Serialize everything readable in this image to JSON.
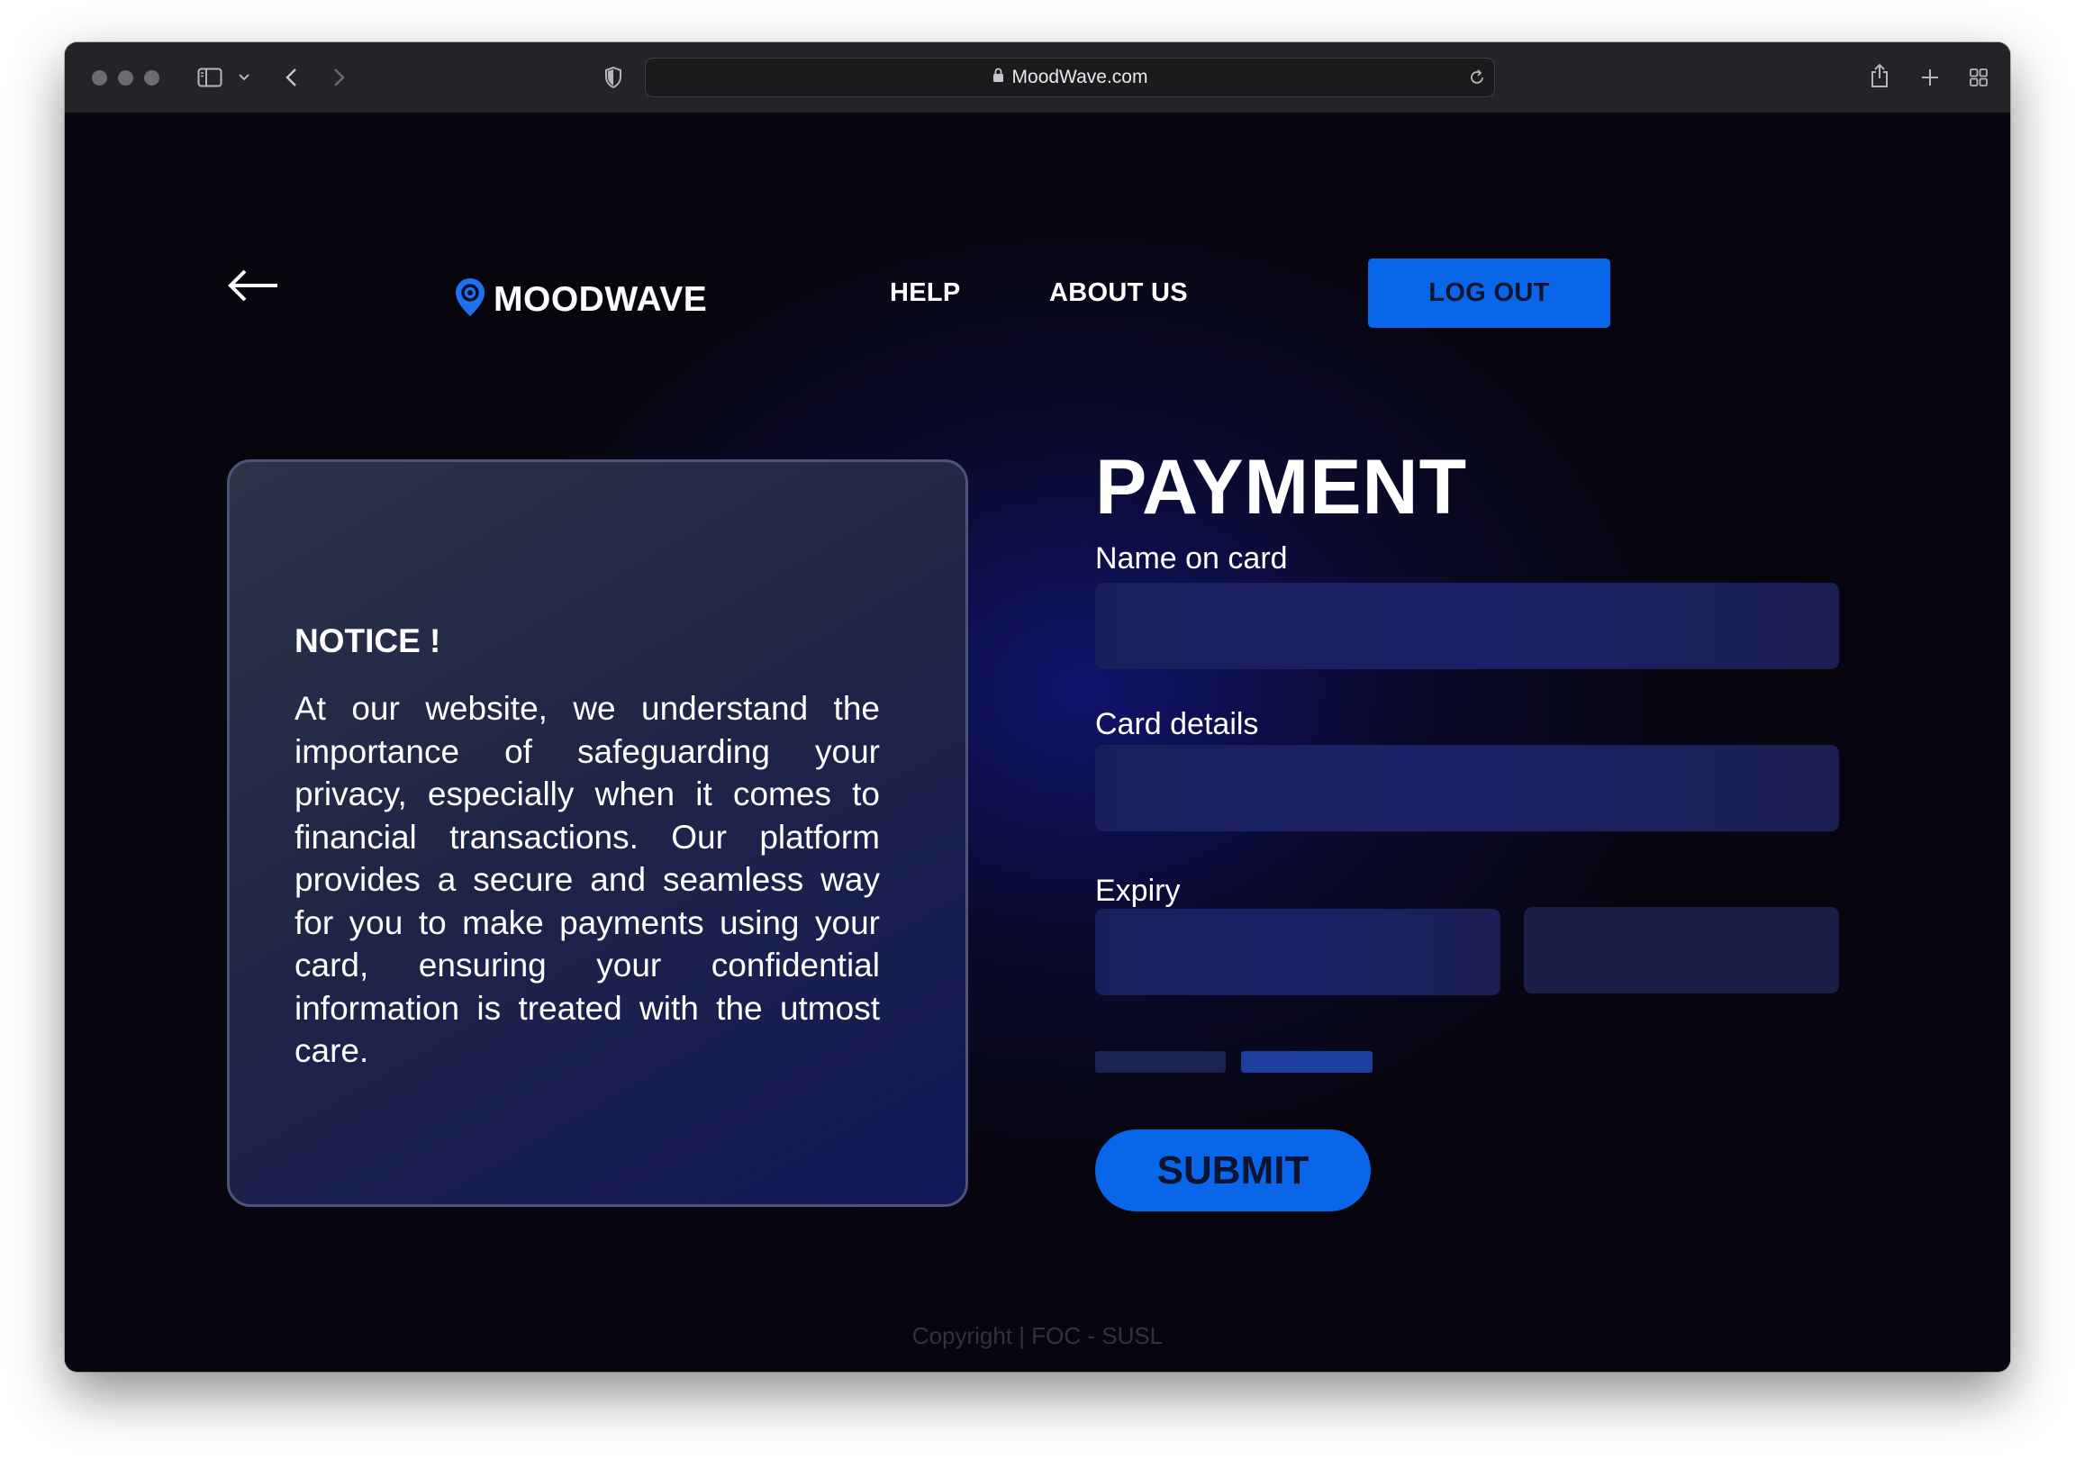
{
  "browser": {
    "url": "MoodWave.com",
    "icons": [
      "sidebar-icon",
      "chevron-down-icon",
      "back-icon",
      "forward-icon",
      "shield-icon",
      "lock-icon",
      "reload-icon",
      "share-icon",
      "plus-icon",
      "tabs-grid-icon"
    ]
  },
  "header": {
    "brand": "MOODWAVE",
    "nav": {
      "help": "HELP",
      "about": "ABOUT US"
    },
    "logout_label": "LOG OUT",
    "accent_color": "#0a66e8"
  },
  "notice": {
    "title": "NOTICE !",
    "body": "At our website, we understand the importance of safeguarding your privacy, especially when it comes to financial transactions. Our platform provides a secure and seamless way for you to make payments using your card, ensuring your confidential information is treated with the utmost care."
  },
  "form": {
    "title": "PAYMENT",
    "name_label": "Name on card",
    "name_value": "",
    "card_label": "Card details",
    "card_value": "",
    "expiry_label": "Expiry",
    "expiry_month_value": "",
    "expiry_year_value": "",
    "submit_label": "SUBMIT"
  },
  "footer": {
    "copyright": "Copyright | FOC - SUSL"
  }
}
